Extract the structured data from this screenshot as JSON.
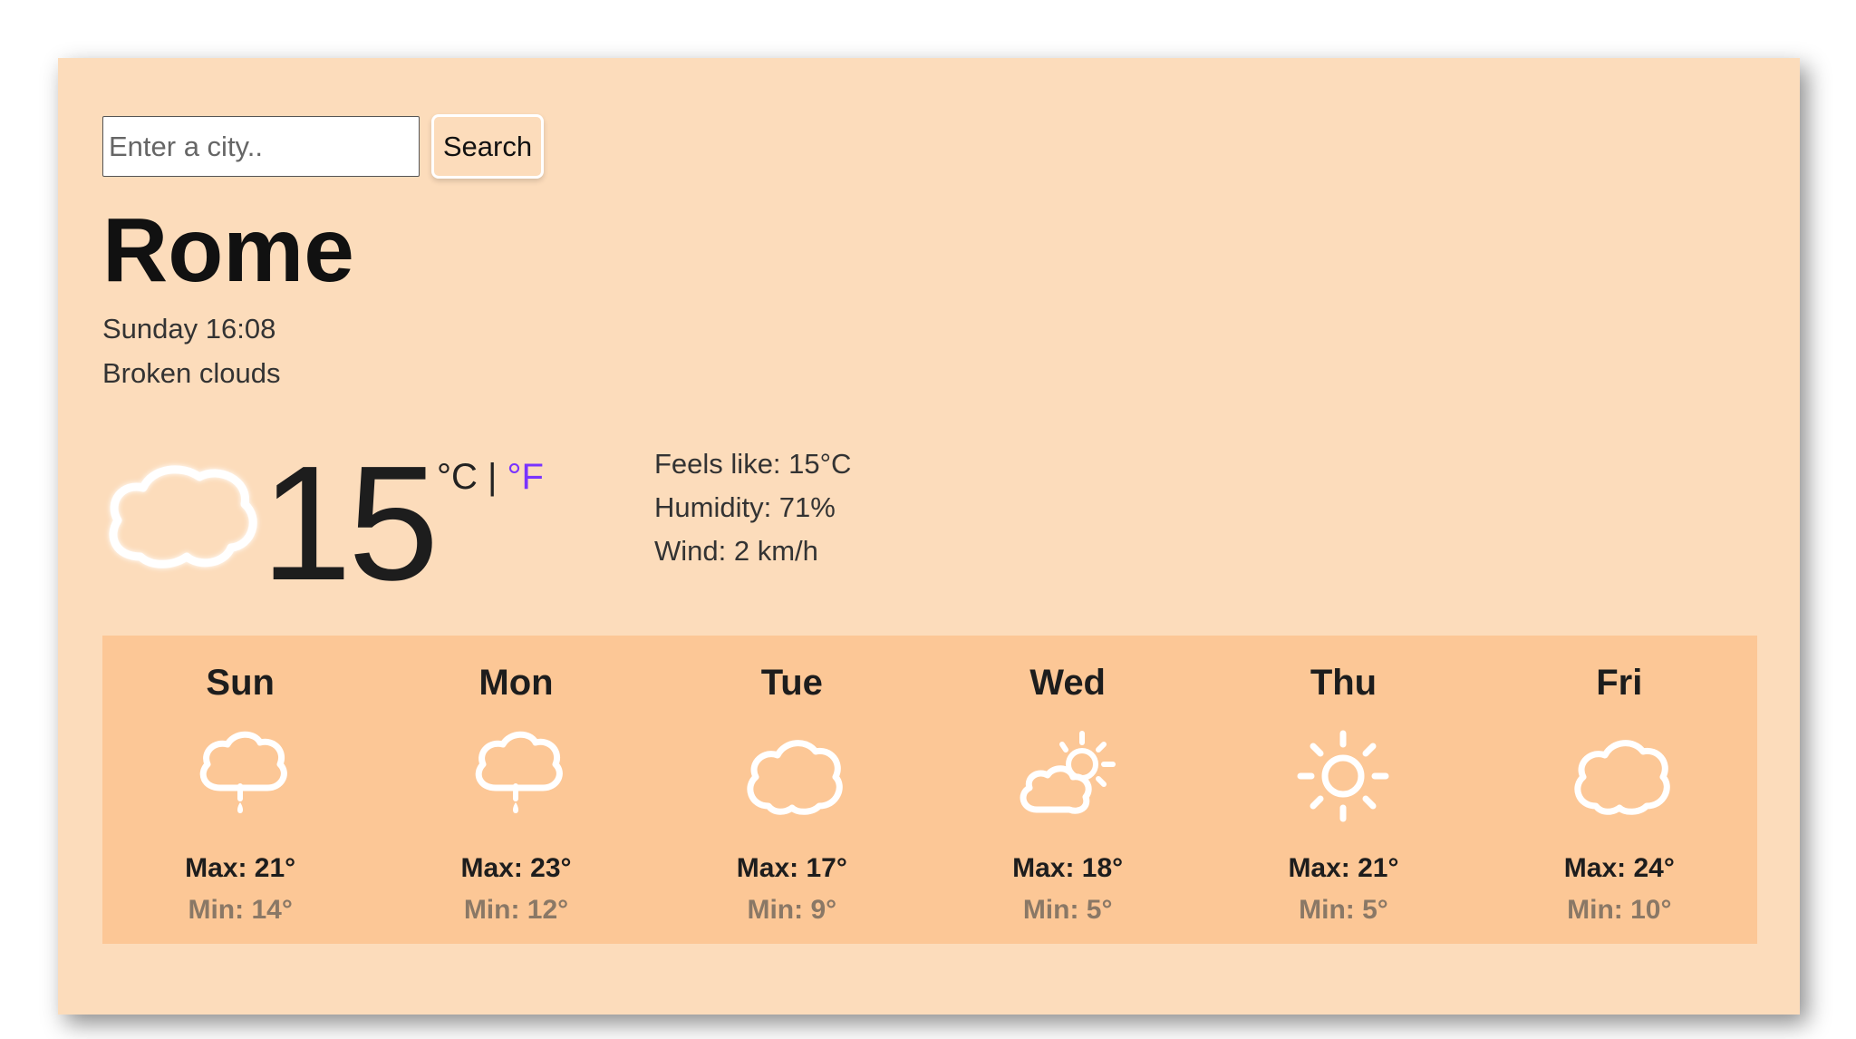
{
  "search": {
    "placeholder": "Enter a city..",
    "button_label": "Search"
  },
  "current": {
    "city": "Rome",
    "datetime": "Sunday 16:08",
    "description": "Broken clouds",
    "icon": "cloud-icon",
    "temperature": "15",
    "unit_celsius": "°C",
    "unit_separator": "|",
    "unit_fahrenheit": "°F",
    "feels_like": "Feels like: 15°C",
    "humidity": "Humidity: 71%",
    "wind": "Wind: 2 km/h"
  },
  "forecast": [
    {
      "day": "Sun",
      "icon": "rain-cloud-icon",
      "max": "Max: 21°",
      "min": "Min: 14°"
    },
    {
      "day": "Mon",
      "icon": "rain-cloud-icon",
      "max": "Max: 23°",
      "min": "Min: 12°"
    },
    {
      "day": "Tue",
      "icon": "cloud-icon",
      "max": "Max: 17°",
      "min": "Min: 9°"
    },
    {
      "day": "Wed",
      "icon": "partly-cloudy-icon",
      "max": "Max: 18°",
      "min": "Min: 5°"
    },
    {
      "day": "Thu",
      "icon": "sun-icon",
      "max": "Max: 21°",
      "min": "Min: 5°"
    },
    {
      "day": "Fri",
      "icon": "cloud-icon",
      "max": "Max: 24°",
      "min": "Min: 10°"
    }
  ],
  "colors": {
    "card_background": "#fcdcbb",
    "forecast_background": "#fcc796",
    "accent_fahrenheit": "#7a33ff",
    "icon_color": "#ffffff"
  }
}
